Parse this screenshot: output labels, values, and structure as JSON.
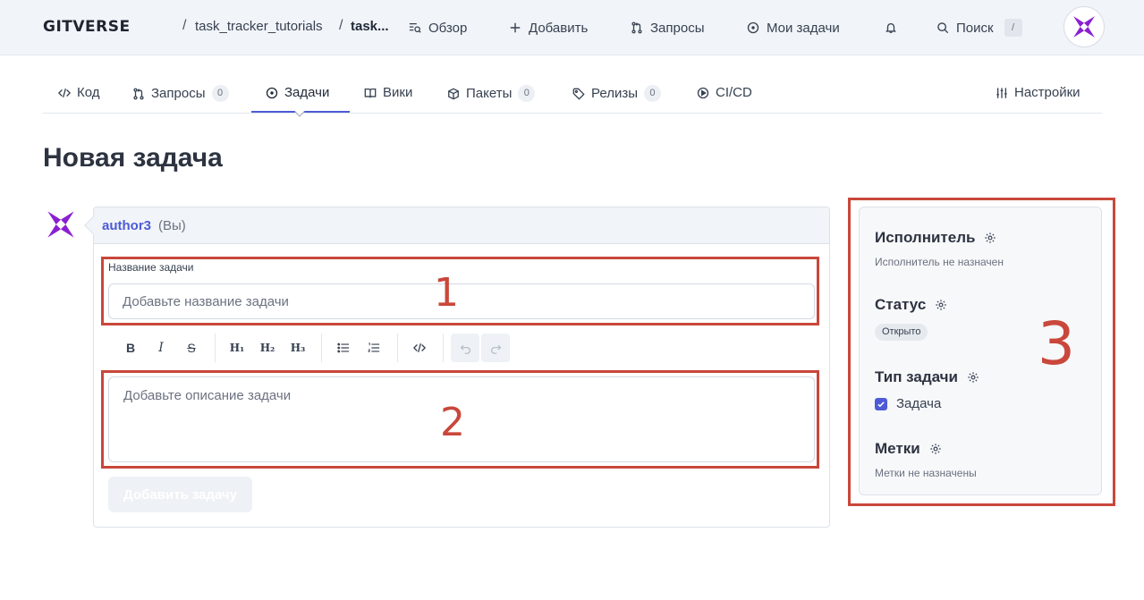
{
  "header": {
    "logo": "GITVERSE",
    "crumb_sep": "/",
    "owner": "task_tracker_tutorials",
    "repo": "task...",
    "nav": [
      {
        "label": "Обзор",
        "icon": "overview-icon"
      },
      {
        "label": "Добавить",
        "icon": "plus-icon"
      },
      {
        "label": "Запросы",
        "icon": "pull-request-icon"
      },
      {
        "label": "Мои задачи",
        "icon": "issue-icon"
      }
    ],
    "notifications_icon": "bell-icon",
    "search_label": "Поиск",
    "search_shortcut": "/"
  },
  "tabs": [
    {
      "label": "Код",
      "icon": "code-icon"
    },
    {
      "label": "Запросы",
      "icon": "pull-request-icon",
      "count": "0"
    },
    {
      "label": "Задачи",
      "icon": "issue-icon",
      "active": true
    },
    {
      "label": "Вики",
      "icon": "book-icon"
    },
    {
      "label": "Пакеты",
      "icon": "package-icon",
      "count": "0"
    },
    {
      "label": "Релизы",
      "icon": "tag-icon",
      "count": "0"
    },
    {
      "label": "CI/CD",
      "icon": "play-icon"
    },
    {
      "label": "Настройки",
      "icon": "settings-sliders-icon"
    }
  ],
  "page_title": "Новая задача",
  "form": {
    "author": "author3",
    "author_suffix": "(Вы)",
    "title_label": "Название задачи",
    "title_placeholder": "Добавьте название задачи",
    "toolbar": {
      "bold": "B",
      "italic": "I",
      "strike": "S",
      "h1": "H₁",
      "h2": "H₂",
      "h3": "H₃"
    },
    "description_placeholder": "Добавьте описание задачи",
    "submit_label": "Добавить задачу"
  },
  "sidebar": {
    "assignee": {
      "title": "Исполнитель",
      "value": "Исполнитель не назначен"
    },
    "status": {
      "title": "Статус",
      "value": "Открыто"
    },
    "type": {
      "title": "Тип задачи",
      "value": "Задача",
      "checked": true
    },
    "labels": {
      "title": "Метки",
      "value": "Метки не назначены"
    }
  },
  "annotations": [
    "1",
    "2",
    "3"
  ],
  "colors": {
    "accent": "#4d5bd6",
    "annotation": "#c9473b",
    "logo_purple": "#8a1fd1"
  }
}
